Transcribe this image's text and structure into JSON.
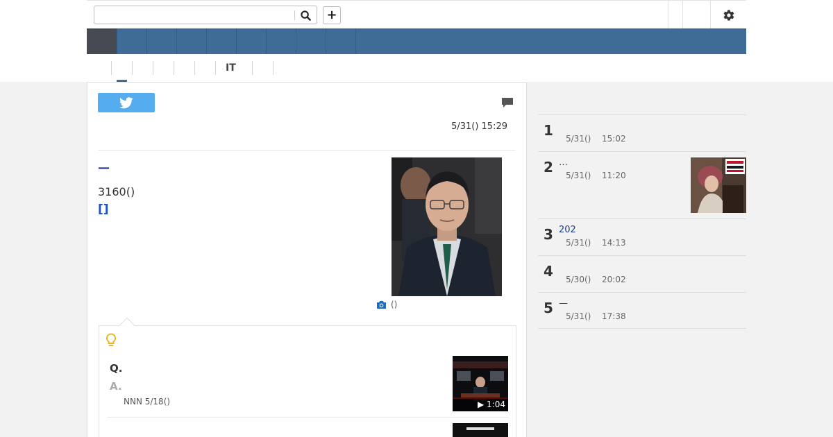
{
  "header": {
    "search": {
      "value": "",
      "placeholder": ""
    },
    "add_label": "+"
  },
  "nav": {
    "main_items": [
      "",
      "",
      "",
      "",
      "",
      "",
      "",
      "",
      ""
    ],
    "sub_items": [
      "",
      "",
      "",
      "",
      "",
      "IT",
      "",
      ""
    ]
  },
  "article": {
    "date": "5/31() 15:29",
    "headline": "—",
    "summary": "3160()",
    "more_label": "[]",
    "photo_caption": "()",
    "qa": {
      "q_label": "Q.",
      "a_label": "A.",
      "source": "NNN 5/18()",
      "video_duration": "▶ 1:04"
    }
  },
  "ranking": {
    "items": [
      {
        "rank": "1",
        "title": "",
        "date": "5/31()",
        "time": "15:02"
      },
      {
        "rank": "2",
        "title": "…",
        "date": "5/31()",
        "time": "11:20"
      },
      {
        "rank": "3",
        "title": "202",
        "date": "5/31()",
        "time": "14:13"
      },
      {
        "rank": "4",
        "title": "",
        "date": "5/30()",
        "time": "20:02"
      },
      {
        "rank": "5",
        "title": "—",
        "date": "5/31()",
        "time": "17:38"
      }
    ]
  },
  "colors": {
    "nav_bg": "#3f6b97",
    "nav_active": "#464a53",
    "twitter": "#55acee",
    "link": "#1a3d94",
    "accent_blue": "#1a4fd1"
  },
  "icons": [
    "search-icon",
    "plus-icon",
    "gear-icon",
    "twitter-icon",
    "comment-icon",
    "camera-icon",
    "lightbulb-icon",
    "play-icon"
  ]
}
